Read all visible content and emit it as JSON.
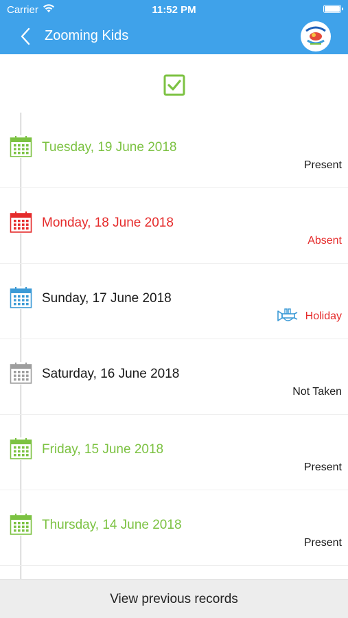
{
  "status_bar": {
    "carrier": "Carrier",
    "time": "11:52 PM"
  },
  "navbar": {
    "title": "Zooming Kids"
  },
  "colors": {
    "accent": "#3fa2ea",
    "present": "#7cc242",
    "absent": "#e52b2b",
    "holiday": "#e52b2b",
    "holiday_icon": "#3b9ad6",
    "not_taken": "#9e9e9e",
    "default_text": "#1a1a1a"
  },
  "records": [
    {
      "date": "Tuesday, 19 June 2018",
      "status": "Present",
      "date_color": "#7cc242",
      "status_color": "#1a1a1a",
      "icon_color": "#7cc242"
    },
    {
      "date": "Monday, 18 June 2018",
      "status": "Absent",
      "date_color": "#e52b2b",
      "status_color": "#e52b2b",
      "icon_color": "#e52b2b"
    },
    {
      "date": "Sunday, 17 June 2018",
      "status": "Holiday",
      "date_color": "#1a1a1a",
      "status_color": "#e52b2b",
      "icon_color": "#3b9ad6",
      "status_icon": "trumpet-icon"
    },
    {
      "date": "Saturday, 16 June 2018",
      "status": "Not Taken",
      "date_color": "#1a1a1a",
      "status_color": "#1a1a1a",
      "icon_color": "#9e9e9e"
    },
    {
      "date": "Friday, 15 June 2018",
      "status": "Present",
      "date_color": "#7cc242",
      "status_color": "#1a1a1a",
      "icon_color": "#7cc242"
    },
    {
      "date": "Thursday, 14 June 2018",
      "status": "Present",
      "date_color": "#7cc242",
      "status_color": "#1a1a1a",
      "icon_color": "#7cc242"
    }
  ],
  "footer": {
    "label": "View previous records"
  }
}
